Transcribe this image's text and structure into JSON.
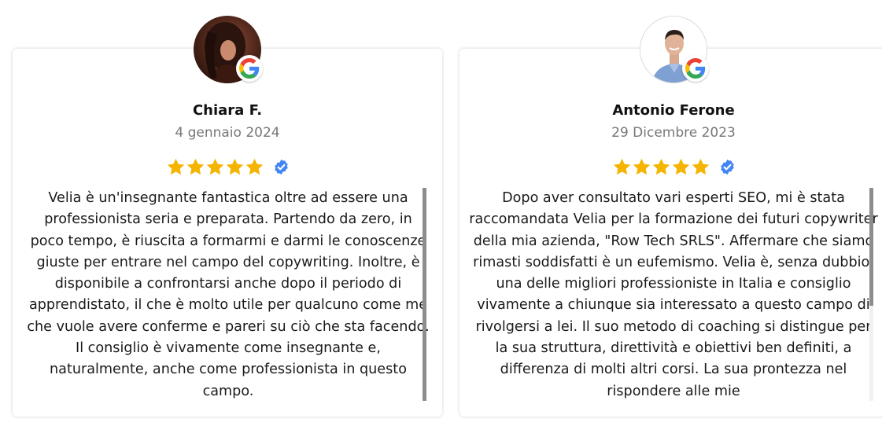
{
  "reviews": [
    {
      "name": "Chiara F.",
      "date": "4 gennaio 2024",
      "rating": 5,
      "text": "Velia è un'insegnante fantastica oltre ad essere una professionista seria e preparata. Partendo da zero, in poco tempo, è riuscita a formarmi e darmi le conoscenze giuste per entrare nel campo del copywriting. Inoltre, è disponibile a confrontarsi anche dopo il periodo di apprendistato, il che è molto utile per qualcuno come me che vuole avere conferme e pareri su ciò che sta facendo. Il consiglio è vivamente come insegnante e, naturalmente, anche come professionista in questo campo."
    },
    {
      "name": "Antonio Ferone",
      "date": "29 Dicembre 2023",
      "rating": 5,
      "text": "Dopo aver consultato vari esperti SEO, mi è stata raccomandata Velia per la formazione dei futuri copywriter della mia azienda, \"Row Tech SRLS\". Affermare che siamo rimasti soddisfatti è un eufemismo. Velia è, senza dubbio, una delle migliori professioniste in Italia e consiglio vivamente a chiunque sia interessato a questo campo di rivolgersi a lei. Il suo metodo di coaching si distingue per la sua struttura, direttività e obiettivi ben definiti, a differenza di molti altri corsi. La sua prontezza nel rispondere alle mie"
    }
  ],
  "icons": {
    "badge": "google-icon",
    "verified": "verified-check-icon",
    "star": "star-icon"
  },
  "colors": {
    "star": "#f5b400",
    "verified": "#4285f4",
    "date": "#777777",
    "scrollbar": "#8d8d8d"
  }
}
